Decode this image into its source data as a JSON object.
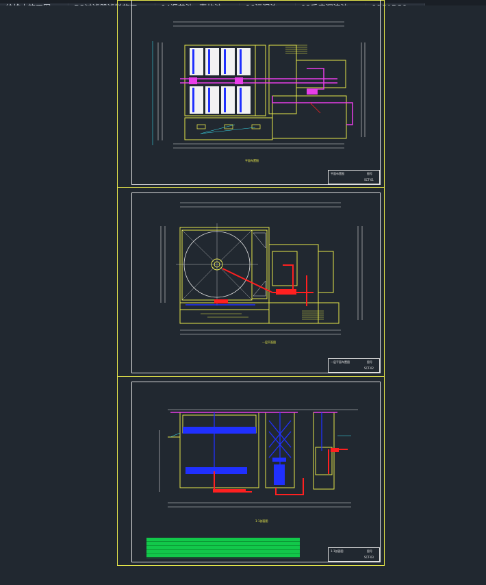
{
  "tabs": [
    {
      "label": "给排水施工图",
      "close": "×"
    },
    {
      "label": "D2过滤器滤料施工",
      "close": "×"
    },
    {
      "label": "04调节池+事故池",
      "close": "×"
    },
    {
      "label": "06污泥池",
      "close": "×"
    },
    {
      "label": "08反应沉淀池",
      "close": "×"
    },
    {
      "label": "00CAD30",
      "close": "×"
    }
  ],
  "sheets": [
    {
      "title_block": {
        "name": "平面布置图",
        "code": "SCT-01",
        "label": "图号"
      },
      "caption": "平面布置图"
    },
    {
      "title_block": {
        "name": "一层平面布置图",
        "code": "SCT-02",
        "label": "图号"
      },
      "caption": "一层平面图"
    },
    {
      "title_block": {
        "name": "1-1剖面图",
        "code": "SCT-03",
        "label": "图号"
      },
      "caption": "1-1剖面图"
    }
  ],
  "colors": {
    "background": "#212830",
    "border": "#e8e84a",
    "frame": "#e0e0e0",
    "pipe_magenta": "#e83ee8",
    "pipe_red": "#ff2020",
    "blue": "#2030ff",
    "cyan": "#3ad8e8",
    "green": "#12c84a"
  }
}
